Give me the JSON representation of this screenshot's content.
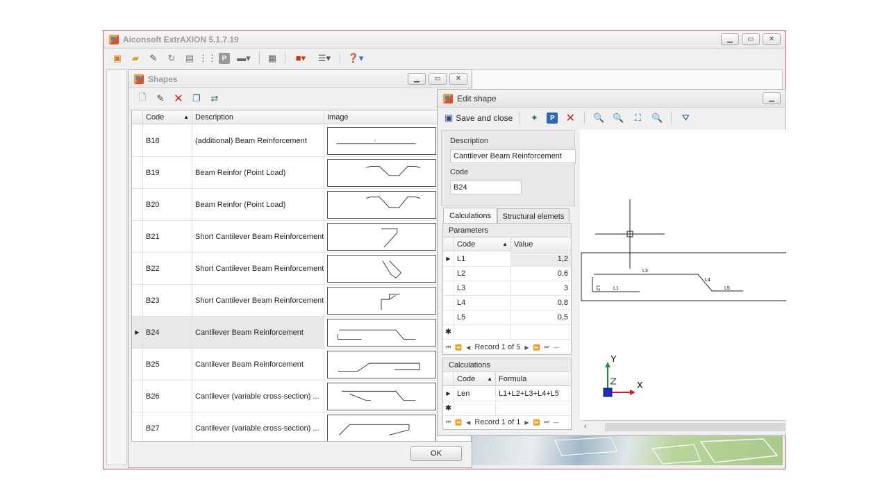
{
  "app": {
    "title": "Aiconsoft ExtrAXION 5.1.7.19",
    "toolbar_icons": [
      "new-project-icon",
      "open-folder-icon",
      "edit-icon",
      "refresh-icon",
      "print-icon",
      "structure-icon",
      "p-icon",
      "calculator-icon",
      "layout-icon",
      "book-icon",
      "list-icon",
      "help-icon"
    ]
  },
  "shapes": {
    "title": "Shapes",
    "toolbar_icons": [
      "new-icon",
      "edit-icon",
      "delete-icon",
      "copy-icon",
      "import-icon"
    ],
    "columns": {
      "code": "Code",
      "description": "Description",
      "image": "Image"
    },
    "rows": [
      {
        "code": "B18",
        "description": "(additional) Beam Reinforcement"
      },
      {
        "code": "B19",
        "description": "Beam Reinfor (Point Load)"
      },
      {
        "code": "B20",
        "description": "Beam Reinfor (Point Load)"
      },
      {
        "code": "B21",
        "description": "Short Cantilever Beam Reinforcement"
      },
      {
        "code": "B22",
        "description": "Short Cantilever Beam Reinforcement"
      },
      {
        "code": "B23",
        "description": "Short Cantilever Beam Reinforcement"
      },
      {
        "code": "B24",
        "description": "Cantilever Beam Reinforcement"
      },
      {
        "code": "B25",
        "description": "Cantilever Beam Reinforcement"
      },
      {
        "code": "B26",
        "description": "Cantilever (variable cross-section) ..."
      },
      {
        "code": "B27",
        "description": "Cantilever (variable cross-section) ..."
      }
    ],
    "ok_label": "OK"
  },
  "edit": {
    "title": "Edit shape",
    "save_close_label": "Save and close",
    "description_label": "Description",
    "description_value": "Cantilever Beam Reinforcement",
    "code_label": "Code",
    "code_value": "B24",
    "tabs": [
      "Calculations",
      "Structural elemets"
    ],
    "parameters": {
      "title": "Parameters",
      "col_code": "Code",
      "col_value": "Value",
      "rows": [
        {
          "code": "L1",
          "value": "1,2"
        },
        {
          "code": "L2",
          "value": "0,6"
        },
        {
          "code": "L3",
          "value": "3"
        },
        {
          "code": "L4",
          "value": "0,8"
        },
        {
          "code": "L5",
          "value": "0,5"
        }
      ],
      "nav_text": "Record 1 of 5"
    },
    "calculations": {
      "title": "Calculations",
      "col_code": "Code",
      "col_formula": "Formula",
      "rows": [
        {
          "code": "Len",
          "formula": "L1+L2+L3+L4+L5"
        }
      ],
      "nav_text": "Record 1 of 1"
    },
    "drawing_labels": {
      "l1": "L1",
      "l2": "L2",
      "l3": "L3",
      "l4": "L4",
      "l5": "L5",
      "axis_y": "Y",
      "axis_x": "X"
    }
  }
}
